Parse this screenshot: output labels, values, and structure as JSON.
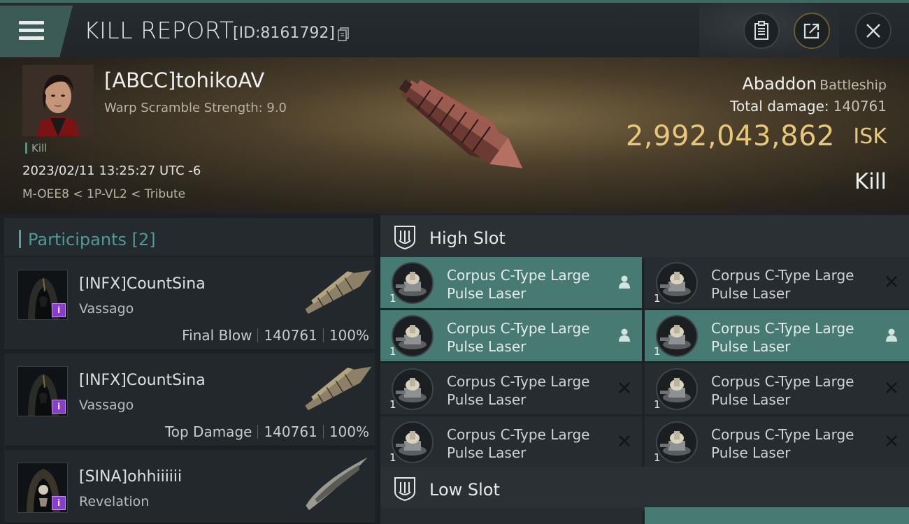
{
  "header": {
    "title": "KILL REPORT",
    "report_id": "[ID:8161792]"
  },
  "victim": {
    "name": "[ABCC]tohikoAV",
    "warp_scramble": "Warp Scramble Strength: 9.0",
    "tag": "Kill",
    "timestamp": "2023/02/11 13:25:27 UTC -6",
    "location": "M-OEE8 < 1P-VL2 < Tribute",
    "ship_name": "Abaddon",
    "ship_class": "Battleship",
    "total_damage_label": "Total damage:",
    "total_damage": "140761",
    "isk_value": "2,992,043,862",
    "isk_unit": "ISK",
    "result": "Kill"
  },
  "participants": {
    "label": "Participants [2]",
    "items": [
      {
        "name": "[INFX]CountSina",
        "ship": "Vassago",
        "role": "Final Blow",
        "damage": "140761",
        "percent": "100%",
        "badge": "i"
      },
      {
        "name": "[INFX]CountSina",
        "ship": "Vassago",
        "role": "Top Damage",
        "damage": "140761",
        "percent": "100%",
        "badge": "i"
      },
      {
        "name": "[SINA]ohhiiiiii",
        "ship": "Revelation",
        "badge": "i"
      }
    ]
  },
  "fitting": {
    "high_slot_label": "High Slot",
    "low_slot_label": "Low Slot",
    "high_slot": [
      {
        "line1": "Corpus C-Type Large",
        "line2": "Pulse Laser",
        "qty": "1",
        "status": "dropped"
      },
      {
        "line1": "Corpus C-Type Large",
        "line2": "Pulse Laser",
        "qty": "1",
        "status": "destroyed"
      },
      {
        "line1": "Corpus C-Type Large",
        "line2": "Pulse Laser",
        "qty": "1",
        "status": "dropped"
      },
      {
        "line1": "Corpus C-Type Large",
        "line2": "Pulse Laser",
        "qty": "1",
        "status": "dropped"
      },
      {
        "line1": "Corpus C-Type Large",
        "line2": "Pulse Laser",
        "qty": "1",
        "status": "destroyed"
      },
      {
        "line1": "Corpus C-Type Large",
        "line2": "Pulse Laser",
        "qty": "1",
        "status": "destroyed"
      },
      {
        "line1": "Corpus C-Type Large",
        "line2": "Pulse Laser",
        "qty": "1",
        "status": "destroyed"
      },
      {
        "line1": "Corpus C-Type Large",
        "line2": "Pulse Laser",
        "qty": "1",
        "status": "destroyed"
      }
    ]
  },
  "colors": {
    "accent": "#467a72",
    "isk": "#e9c77a",
    "participant_accent": "#4f9a91",
    "badge": "#8a3dc9"
  }
}
